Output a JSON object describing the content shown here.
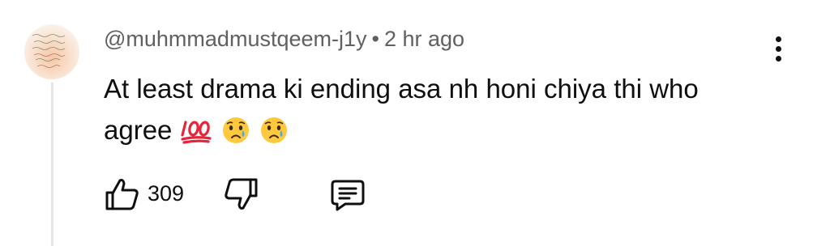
{
  "comment": {
    "username": "@muhmmadmustqeem-j1y",
    "separator": "•",
    "time": "2 hr ago",
    "text_line1": "At least drama ki ending asa nh honi chiya thi who",
    "text_line2": "agree",
    "emojis": [
      "hundred-points-emoji",
      "crying-face-emoji",
      "crying-face-emoji"
    ],
    "like_count": "309",
    "icons": {
      "avatar": "avatar-image",
      "like": "thumbs-up-icon",
      "dislike": "thumbs-down-icon",
      "reply": "reply-comment-icon",
      "menu": "more-vert-icon"
    }
  },
  "colors": {
    "text": "#0f0f0f",
    "meta": "#606060",
    "thread_line": "#e5e5e5",
    "emoji_red": "#e8233a",
    "emoji_face": "#ffc83d"
  }
}
